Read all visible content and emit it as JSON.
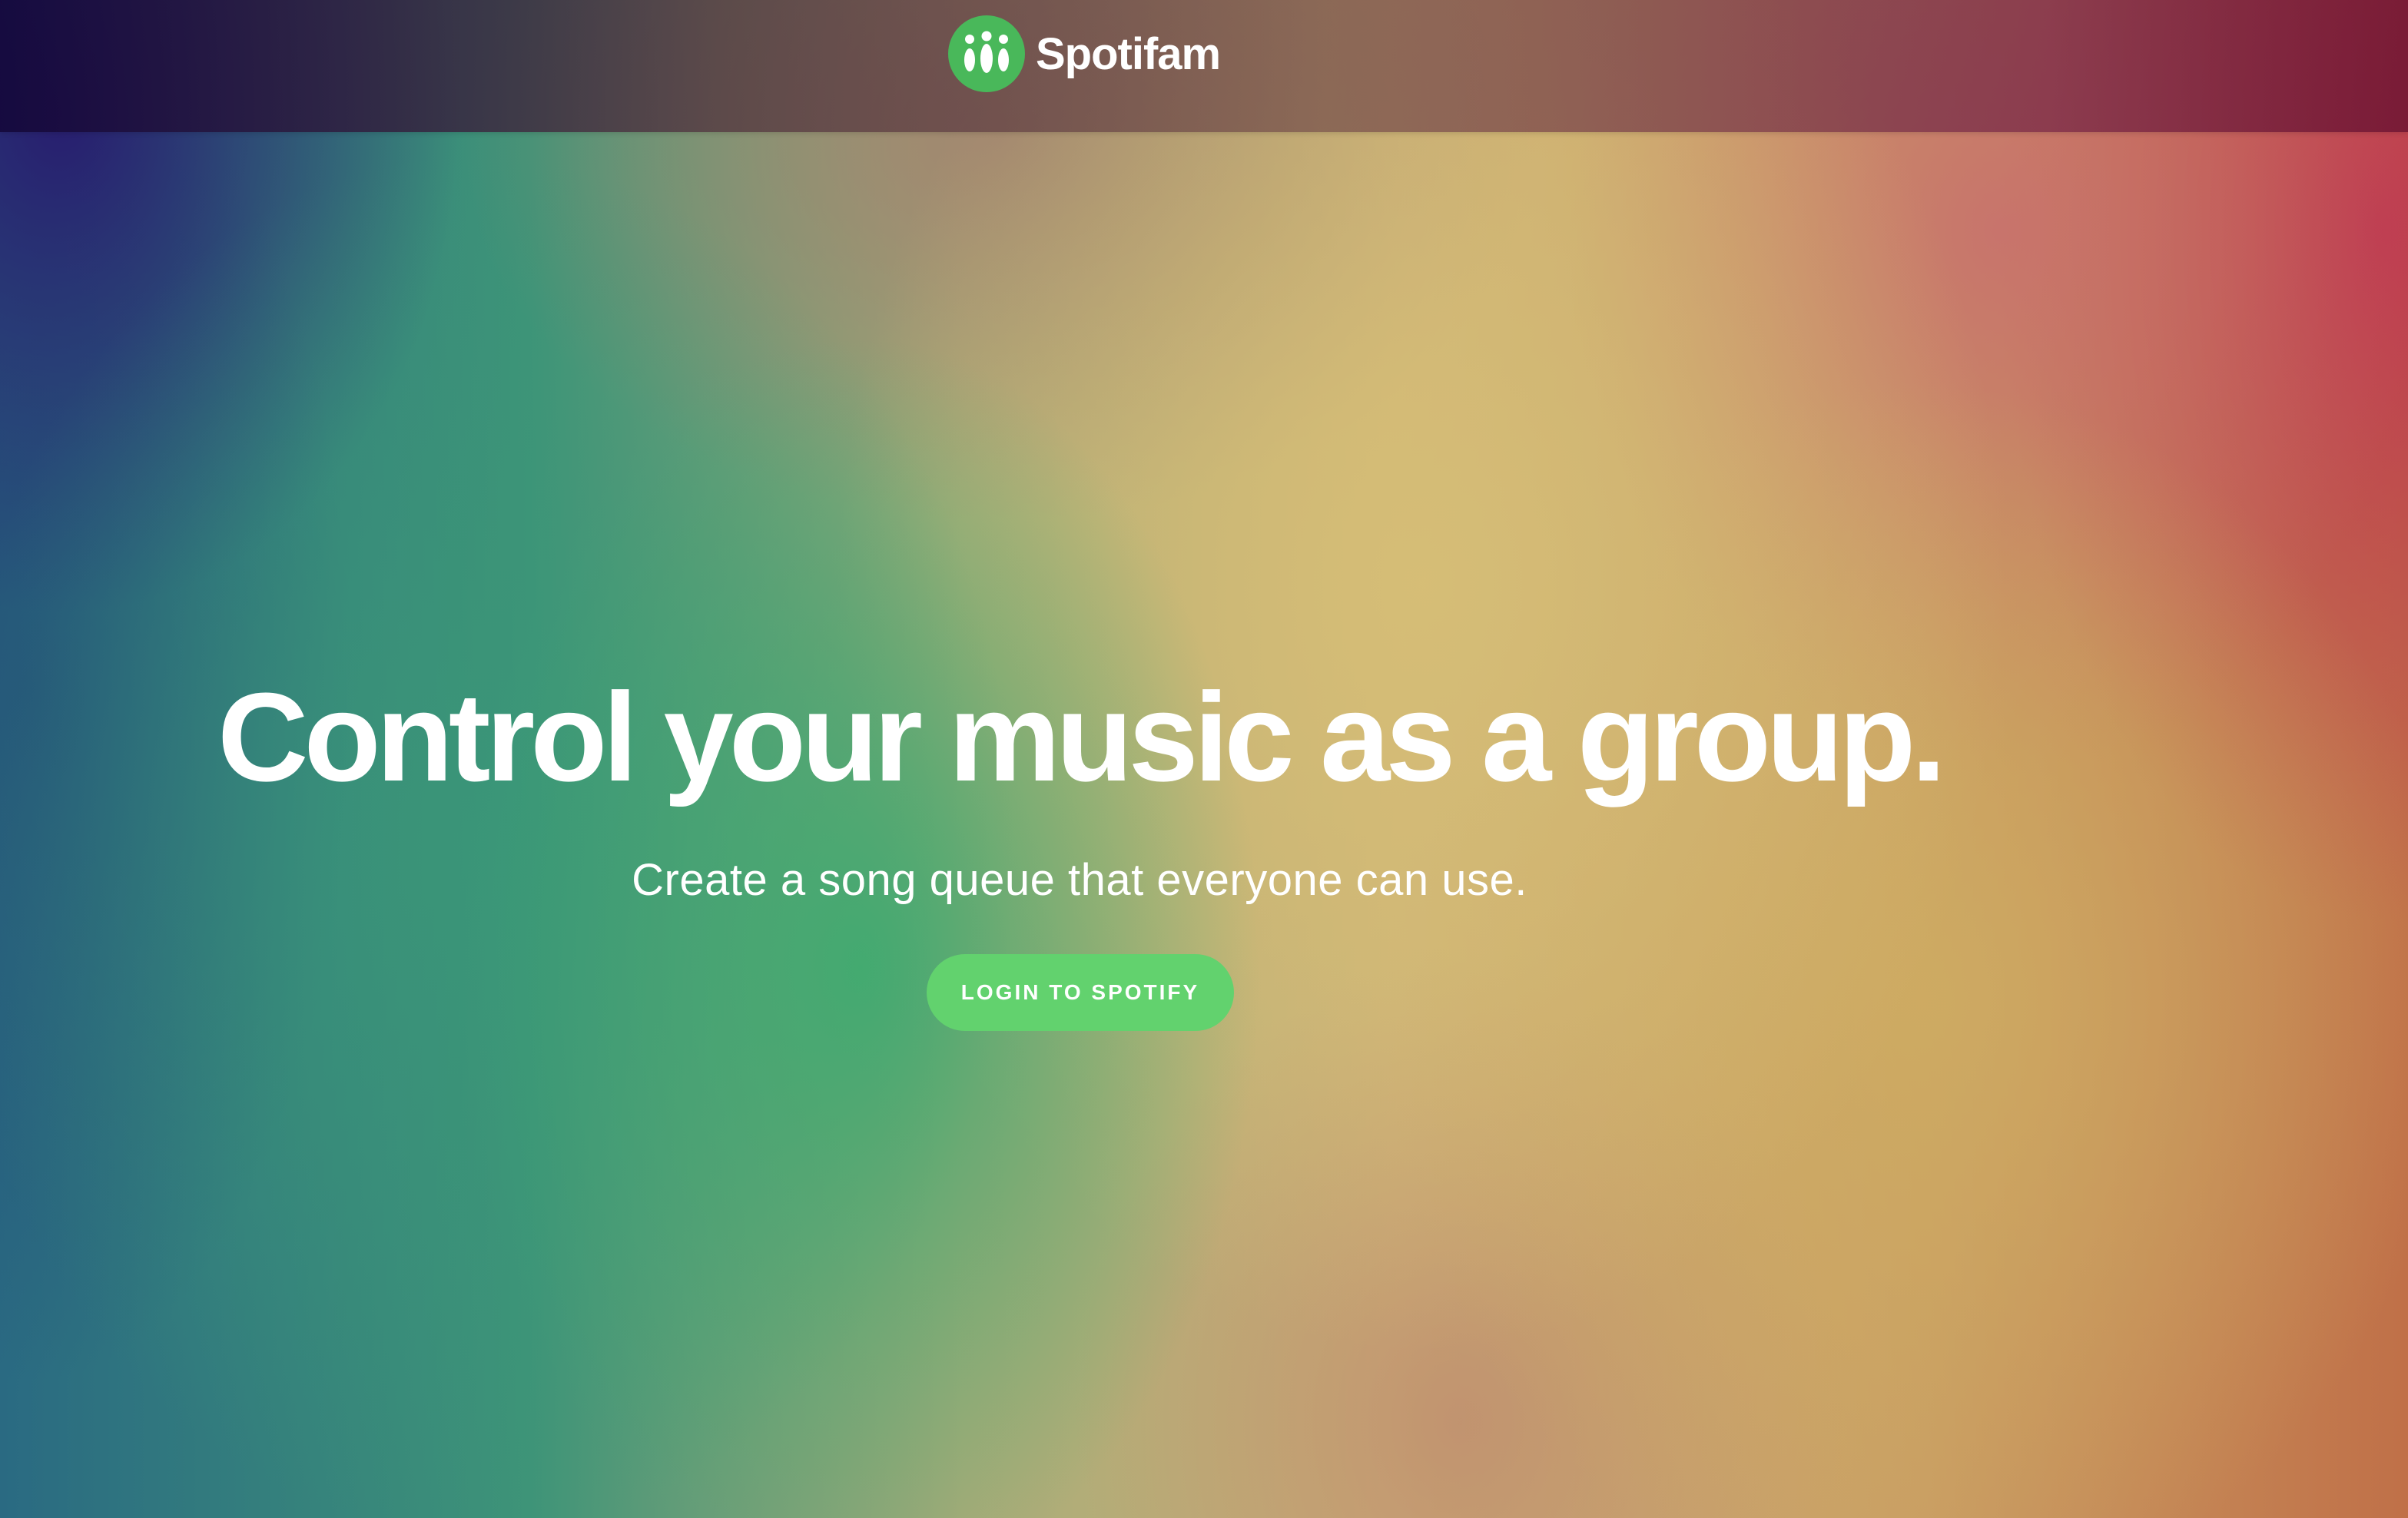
{
  "app": {
    "brand_name": "Spotifam",
    "logo_icon": "people-group-icon",
    "accent_color": "#62d26e"
  },
  "hero": {
    "title": "Control your music as a group.",
    "subtitle": "Create a song queue that everyone can use.",
    "login_button_label": "LOGIN TO SPOTIFY"
  }
}
